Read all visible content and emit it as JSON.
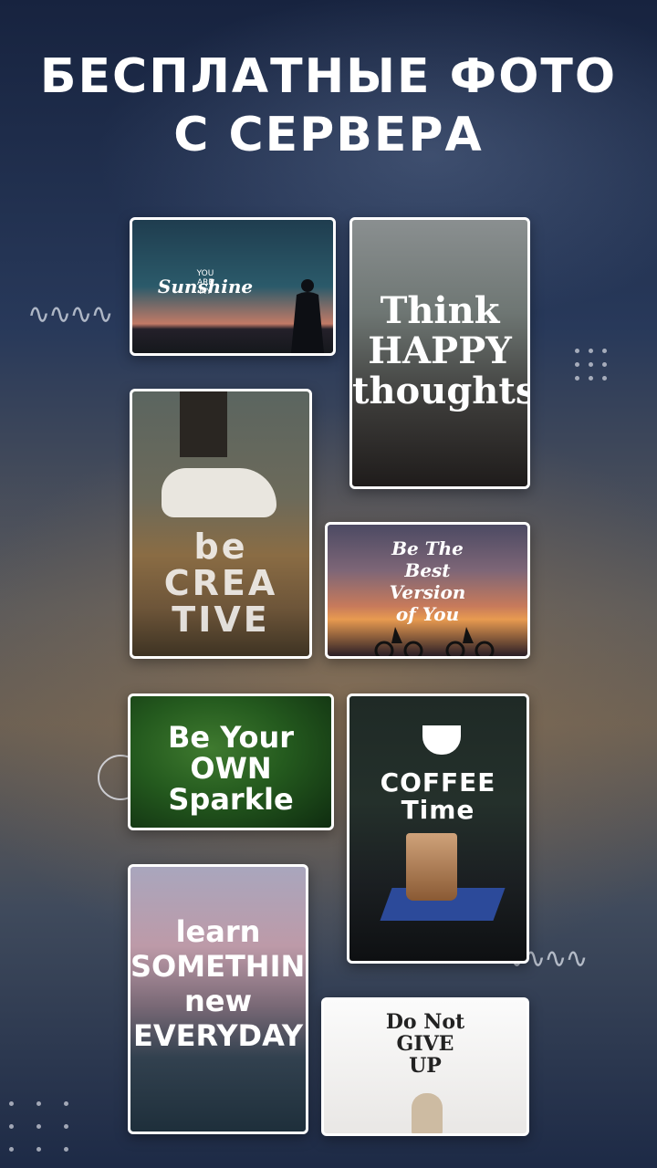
{
  "header": {
    "title_line1": "БЕСПЛАТНЫЕ ФОТО",
    "title_line2": "С СЕРВЕРА"
  },
  "cards": [
    {
      "name": "you-are-my-sunshine",
      "small": "YOU\nARE\nMY",
      "text": "Sunshine"
    },
    {
      "name": "think-happy-thoughts",
      "text": "Think\nHAPPY\nthoughts"
    },
    {
      "name": "be-creative",
      "text": "be\nCREA\nTIVE"
    },
    {
      "name": "be-the-best-version",
      "text": "Be The\nBest\nVersion\nof You"
    },
    {
      "name": "be-your-own-sparkle",
      "text": "Be Your\nOWN\nSparkle"
    },
    {
      "name": "coffee-time",
      "text": "COFFEE\nTime"
    },
    {
      "name": "learn-something-new",
      "text": "learn\nSOMETHING\nnew\nEVERYDAY"
    },
    {
      "name": "do-not-give-up",
      "text": "Do Not\nGIVE\nUP"
    }
  ],
  "decor": {
    "wave": "∿∿∿∿"
  }
}
